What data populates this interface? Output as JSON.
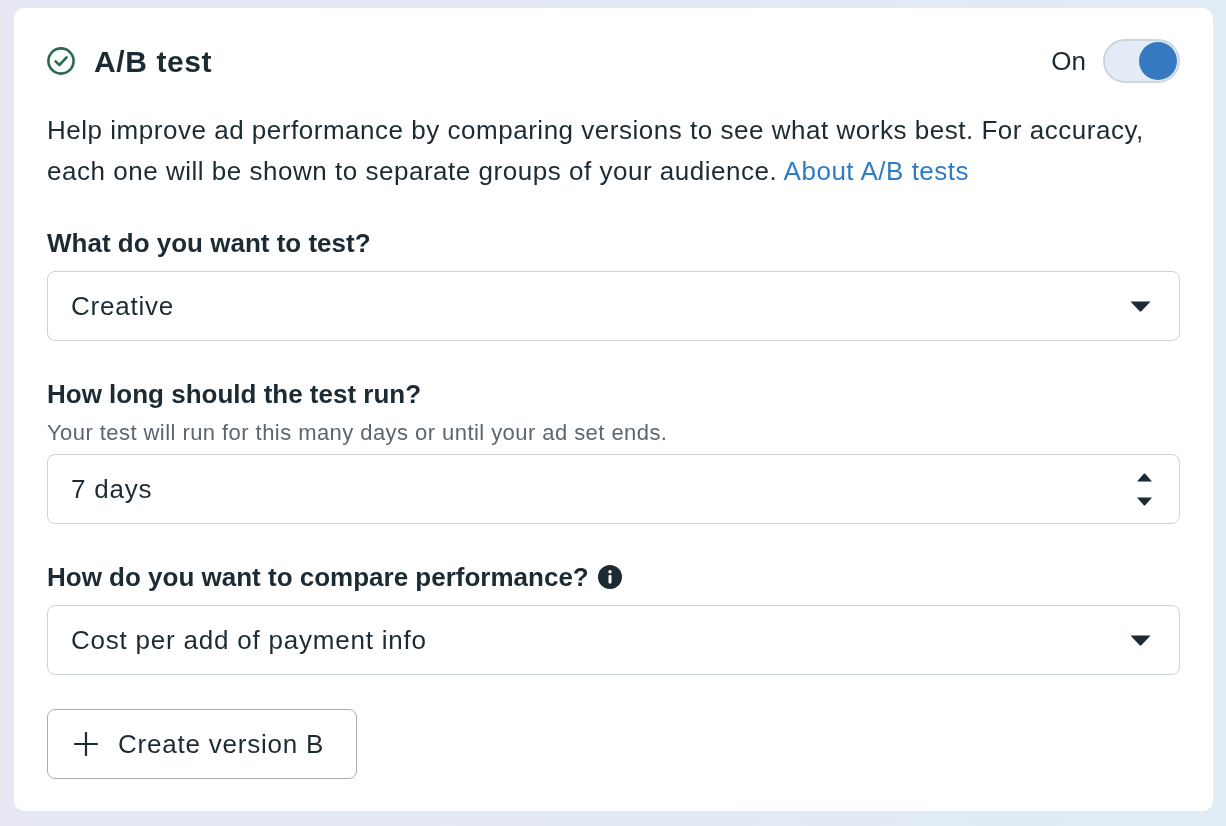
{
  "section": {
    "title": "A/B test",
    "toggle": {
      "label": "On",
      "on": true
    },
    "description": {
      "text": "Help improve ad performance by comparing versions to see what works best. For accuracy, each one will be shown to separate groups of your audience.",
      "link": "About A/B tests"
    },
    "fields": [
      {
        "kind": "select",
        "label": "What do you want to test?",
        "value": "Creative"
      },
      {
        "kind": "number",
        "label": "How long should the test run?",
        "help_text": "Your test will run for this many days or until your ad set ends.",
        "value": "7 days"
      },
      {
        "kind": "select",
        "label": "How do you want to compare performance?",
        "info": true,
        "value": "Cost per add of payment info"
      }
    ],
    "button": {
      "label": "Create version B"
    }
  }
}
